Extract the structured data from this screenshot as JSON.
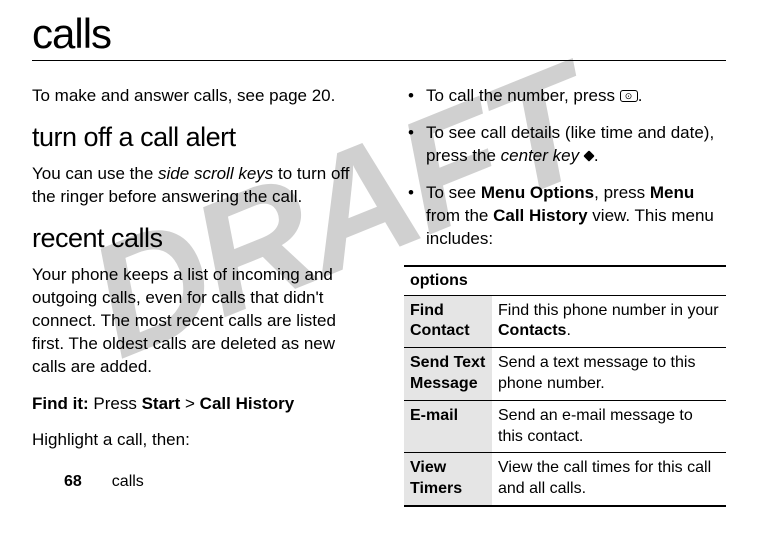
{
  "watermark": "DRAFT",
  "title": "calls",
  "left": {
    "intro": "To make and answer calls, see page 20.",
    "section1_title": "turn off a call alert",
    "section1_p_a": "You can use the ",
    "section1_p_keys": "side scroll keys",
    "section1_p_b": " to turn off the ringer before answering the call.",
    "section2_title": "recent calls",
    "section2_p1": "Your phone keeps a list of incoming and outgoing calls, even for calls that didn't connect. The most recent calls are listed first. The oldest calls are deleted as new calls are added.",
    "findit_label": "Find it:",
    "findit_press": " Press ",
    "findit_start": "Start",
    "findit_gt": " > ",
    "findit_history": "Call History",
    "highlight": "Highlight a call, then:"
  },
  "right": {
    "bullets": [
      {
        "a": "To call the number, press ",
        "icon": "call-key",
        "b": "."
      },
      {
        "a": "To see call details (like time and date), press the ",
        "i": "center key",
        "icon": "center-dot",
        "b": "."
      },
      {
        "a": "To see ",
        "c1": "Menu Options",
        "mid": ", press ",
        "c2": "Menu",
        "mid2": " from the ",
        "c3": "Call History",
        "b": " view. This menu includes:"
      }
    ],
    "options_header": "options",
    "options": [
      {
        "name": "Find Contact",
        "desc_a": "Find this phone number in your ",
        "desc_c": "Contacts",
        "desc_b": "."
      },
      {
        "name": "Send Text Message",
        "desc_a": "Send a text message to this phone number.",
        "desc_c": "",
        "desc_b": ""
      },
      {
        "name": "E-mail",
        "desc_a": "Send an e-mail message to this contact.",
        "desc_c": "",
        "desc_b": ""
      },
      {
        "name": "View Timers",
        "desc_a": "View the call times for this call and all calls.",
        "desc_c": "",
        "desc_b": ""
      }
    ]
  },
  "footer": {
    "page": "68",
    "section": "calls"
  }
}
